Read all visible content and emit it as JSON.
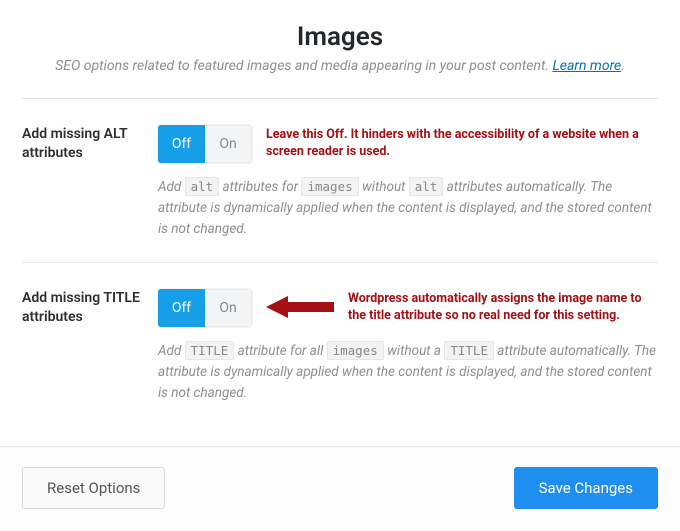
{
  "header": {
    "title": "Images",
    "subtitle_before": "SEO options related to featured images and media appearing in your post content. ",
    "learn_more": "Learn more",
    "subtitle_after": "."
  },
  "settings": [
    {
      "label": "Add missing ALT attributes",
      "toggle": {
        "off": "Off",
        "on": "On",
        "value": "off"
      },
      "annotation": "Leave this Off. It hinders with the accessibility of a website when a screen reader is used.",
      "has_arrow": false,
      "desc_parts": [
        "Add ",
        "alt",
        " attributes for ",
        "images",
        " without ",
        "alt",
        " attributes automatically. The attribute is dynamically applied when the content is displayed, and the stored content is not changed."
      ]
    },
    {
      "label": "Add missing TITLE attributes",
      "toggle": {
        "off": "Off",
        "on": "On",
        "value": "off"
      },
      "annotation": "Wordpress automatically assigns the image name to the title attribute so no real need for this setting.",
      "has_arrow": true,
      "desc_parts": [
        "Add ",
        "TITLE",
        " attribute for all ",
        "images",
        " without a ",
        "TITLE",
        " attribute automatically. The attribute is dynamically applied when the content is displayed, and the stored content is not changed."
      ]
    }
  ],
  "footer": {
    "reset": "Reset Options",
    "save": "Save Changes"
  },
  "colors": {
    "annotation": "#a41014",
    "accent": "#169ee8",
    "primary": "#1f8ef1"
  }
}
